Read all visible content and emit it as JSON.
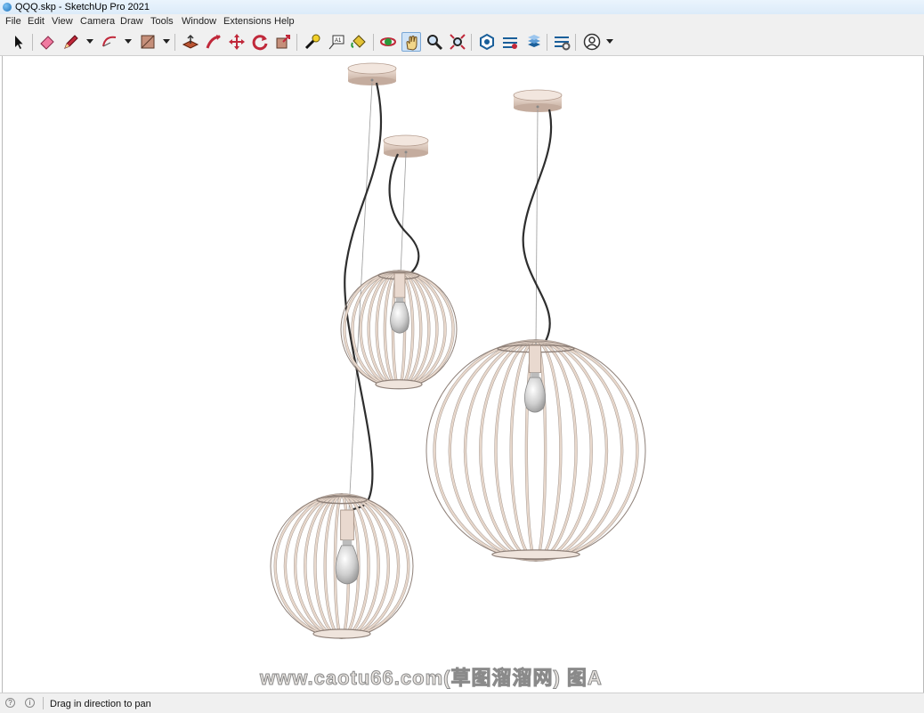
{
  "window": {
    "title": "QQQ.skp - SketchUp Pro 2021"
  },
  "menu": [
    "File",
    "Edit",
    "View",
    "Camera",
    "Draw",
    "Tools",
    "Window",
    "Extensions",
    "Help"
  ],
  "toolbar": [
    "select-icon",
    "eraser-icon",
    "pencil-icon",
    "arc-icon",
    "rectangle-icon",
    "push-pull-icon",
    "follow-me-icon",
    "move-icon",
    "rotate-icon",
    "scale-icon",
    "tape-measure-icon",
    "text-icon",
    "paint-bucket-icon",
    "orbit-icon",
    "pan-icon",
    "zoom-icon",
    "zoom-extents-icon",
    "3d-warehouse-icon",
    "extension-warehouse-icon",
    "layout-icon",
    "extension-manager-icon",
    "profile-icon"
  ],
  "status": {
    "text": "Drag in direction to pan"
  },
  "watermark": "www.caotu66.com(草图溜溜网) 图A",
  "colors": {
    "lamp_cage": "#e8d8cc",
    "cage_edge": "#8f8179",
    "cord": "#2e2e2e",
    "canopy": "#e2cfc3"
  }
}
